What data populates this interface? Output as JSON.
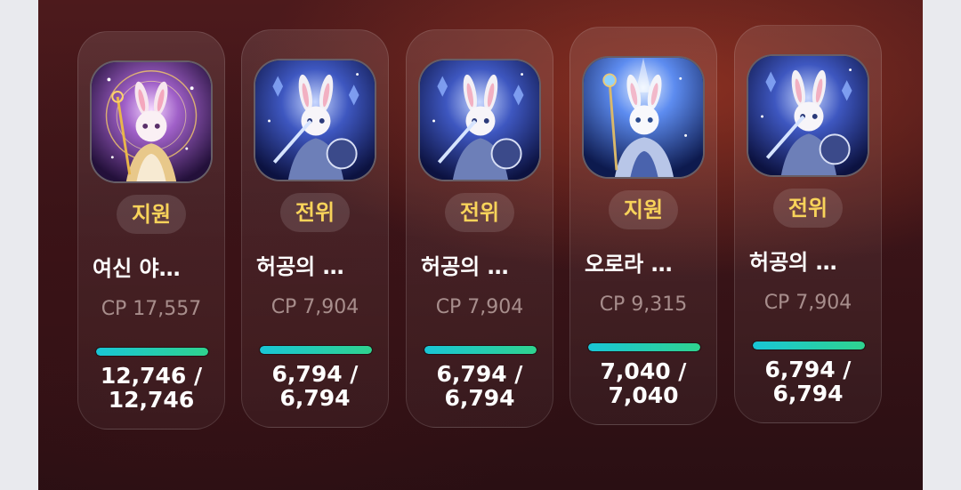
{
  "heroes": [
    {
      "role": "지원",
      "name": "여신 야…",
      "cp": "CP 17,557",
      "hp_line1": "12,746 /",
      "hp_line2": "12,746",
      "hp_fraction": 1.0,
      "portrait": "goddess-rabbit-portrait-icon"
    },
    {
      "role": "전위",
      "name": "허공의 …",
      "cp": "CP 7,904",
      "hp_line1": "6,794 /",
      "hp_line2": "6,794",
      "hp_fraction": 1.0,
      "portrait": "void-knight-rabbit-portrait-icon"
    },
    {
      "role": "전위",
      "name": "허공의 …",
      "cp": "CP 7,904",
      "hp_line1": "6,794 /",
      "hp_line2": "6,794",
      "hp_fraction": 1.0,
      "portrait": "void-knight-rabbit-portrait-icon"
    },
    {
      "role": "지원",
      "name": "오로라 …",
      "cp": "CP 9,315",
      "hp_line1": "7,040 /",
      "hp_line2": "7,040",
      "hp_fraction": 1.0,
      "portrait": "aurora-mage-rabbit-portrait-icon"
    },
    {
      "role": "전위",
      "name": "허공의 …",
      "cp": "CP 7,904",
      "hp_line1": "6,794 /",
      "hp_line2": "6,794",
      "hp_fraction": 1.0,
      "portrait": "void-knight-rabbit-portrait-icon"
    }
  ],
  "colors": {
    "role_text": "#f8d35a",
    "hp_bar_start": "#19c6d6",
    "hp_bar_end": "#2fd38f"
  }
}
